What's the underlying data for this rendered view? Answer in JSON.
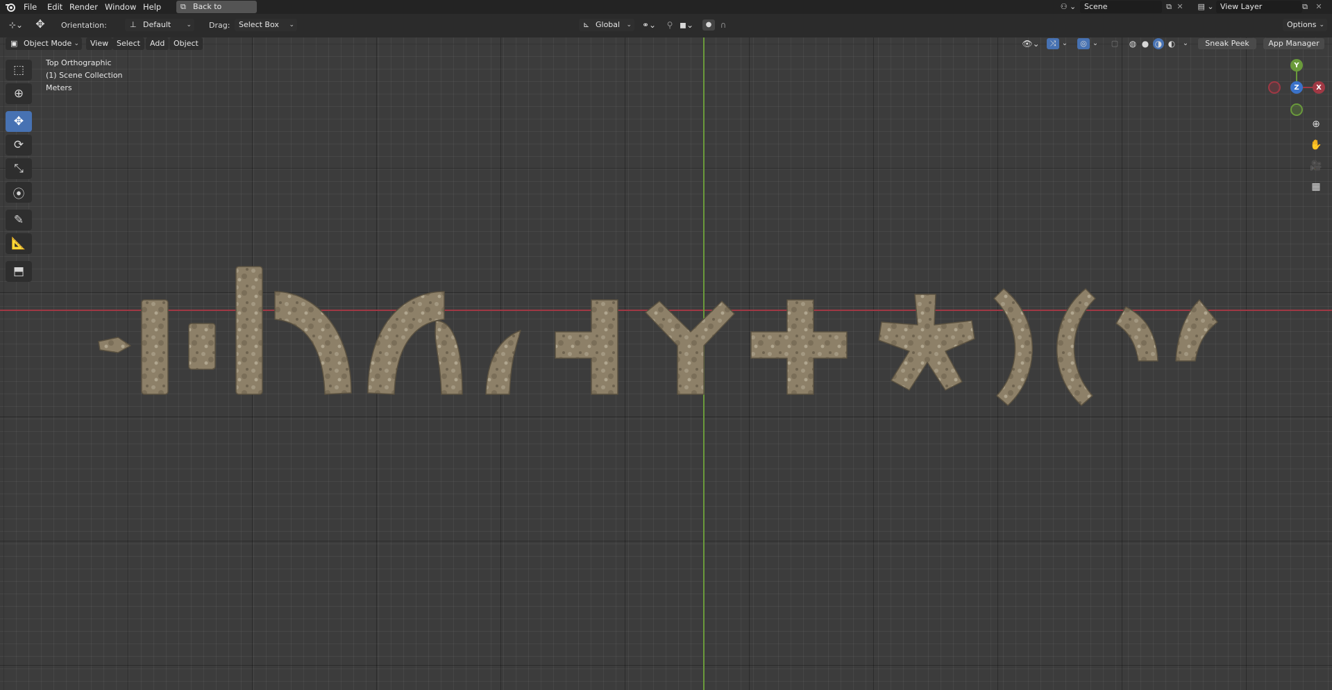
{
  "topbar": {
    "menus": [
      "File",
      "Edit",
      "Render",
      "Window",
      "Help"
    ],
    "back_label": "Back to Previous",
    "scene_value": "Scene",
    "view_layer_value": "View Layer"
  },
  "header": {
    "orientation_label": "Orientation:",
    "orientation_value": "Default",
    "drag_label": "Drag:",
    "drag_value": "Select Box",
    "transform_orientation": "Global",
    "options_label": "Options"
  },
  "viewport_header": {
    "mode": "Object Mode",
    "menus": [
      "View",
      "Select",
      "Add",
      "Object"
    ],
    "sneak_peek": "Sneak Peek",
    "app_manager": "App Manager"
  },
  "overlay": {
    "view_name": "Top Orthographic",
    "collection": "(1) Scene Collection",
    "units": "Meters"
  },
  "gizmo": {
    "x": "X",
    "y": "Y",
    "z": "Z"
  },
  "tools": [
    "select-box-icon",
    "cursor-icon",
    "move-icon",
    "rotate-icon",
    "scale-icon",
    "transform-icon",
    "annotate-icon",
    "measure-icon",
    "add-cube-icon"
  ],
  "colors": {
    "accent": "#4772b3",
    "x_axis": "#a03844",
    "y_axis": "#6a9a3b",
    "stone": "#8d8068"
  }
}
